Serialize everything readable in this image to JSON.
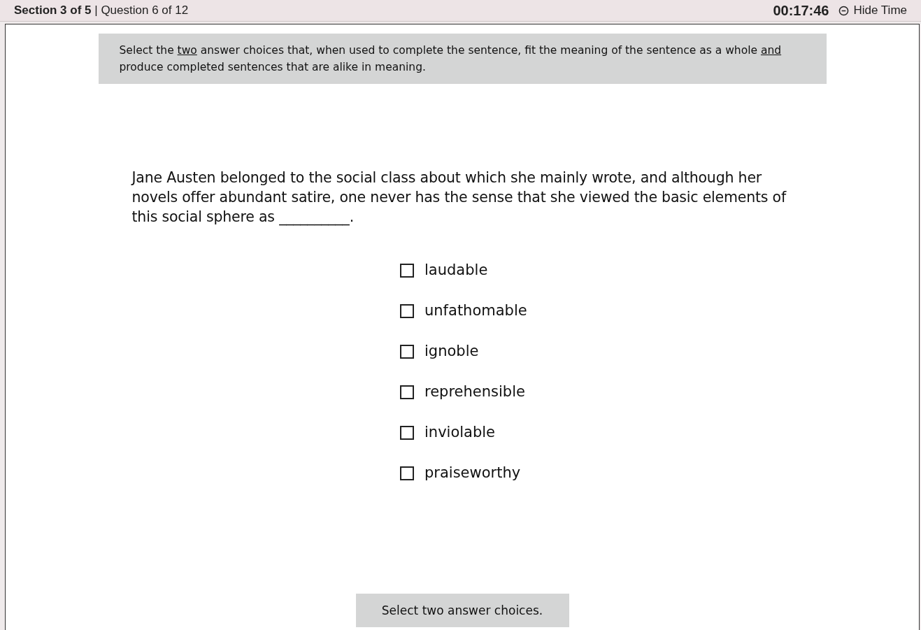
{
  "header": {
    "position": "**Section 3 of 5** | Question 6 of 12",
    "timer": "00:17:46",
    "hide_time": "Hide Time"
  },
  "instruction": [
    {
      "text": "Select the ",
      "underlined": false
    },
    {
      "text": "two",
      "underlined": true
    },
    {
      "text": " answer choices that, when used to complete the sentence, fit the meaning of the sentence as a whole ",
      "underlined": false
    },
    {
      "text": "and",
      "underlined": true
    },
    {
      "text": " produce completed sentences that are alike in meaning.",
      "underlined": false
    }
  ],
  "passage": "Jane Austen belonged to the social class about which she mainly wrote, and although her novels offer abundant satire, one never has the sense that she viewed the basic elements of this social sphere as __________.",
  "choices": [
    {
      "label": "laudable",
      "checked": false
    },
    {
      "label": "unfathomable",
      "checked": false
    },
    {
      "label": "ignoble",
      "checked": false
    },
    {
      "label": "reprehensible",
      "checked": false
    },
    {
      "label": "inviolable",
      "checked": false
    },
    {
      "label": "praiseworthy",
      "checked": false
    }
  ],
  "status_note": "Select two answer choices."
}
